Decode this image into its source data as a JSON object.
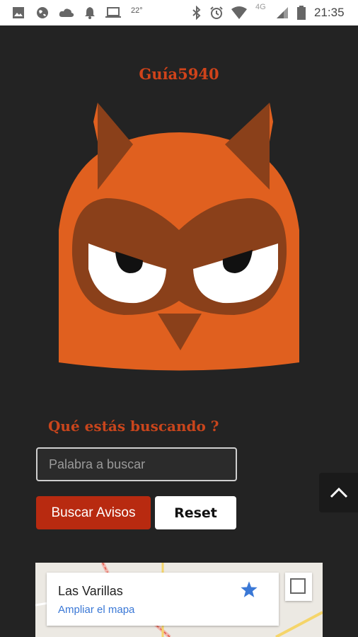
{
  "status_bar": {
    "temperature": "22°",
    "network": "4G",
    "time": "21:35",
    "icons": [
      "image-icon",
      "globe-icon",
      "cloud-icon",
      "bell-icon",
      "laptop-icon",
      "bluetooth-icon",
      "alarm-icon",
      "wifi-icon",
      "signal-icon",
      "battery-icon"
    ]
  },
  "header": {
    "brand": "Guía5940"
  },
  "search": {
    "question": "Qué estás buscando ?",
    "placeholder": "Palabra a buscar",
    "submit_label": "Buscar Avisos",
    "reset_label": "Reset"
  },
  "map": {
    "place_name": "Las Varillas",
    "link_label": "Ampliar el mapa"
  },
  "colors": {
    "background": "#232323",
    "brand": "#d0431a",
    "owl_body": "#e0601f",
    "owl_dark": "#8a401a",
    "submit_button": "#b82a10",
    "link": "#3a78d6"
  }
}
